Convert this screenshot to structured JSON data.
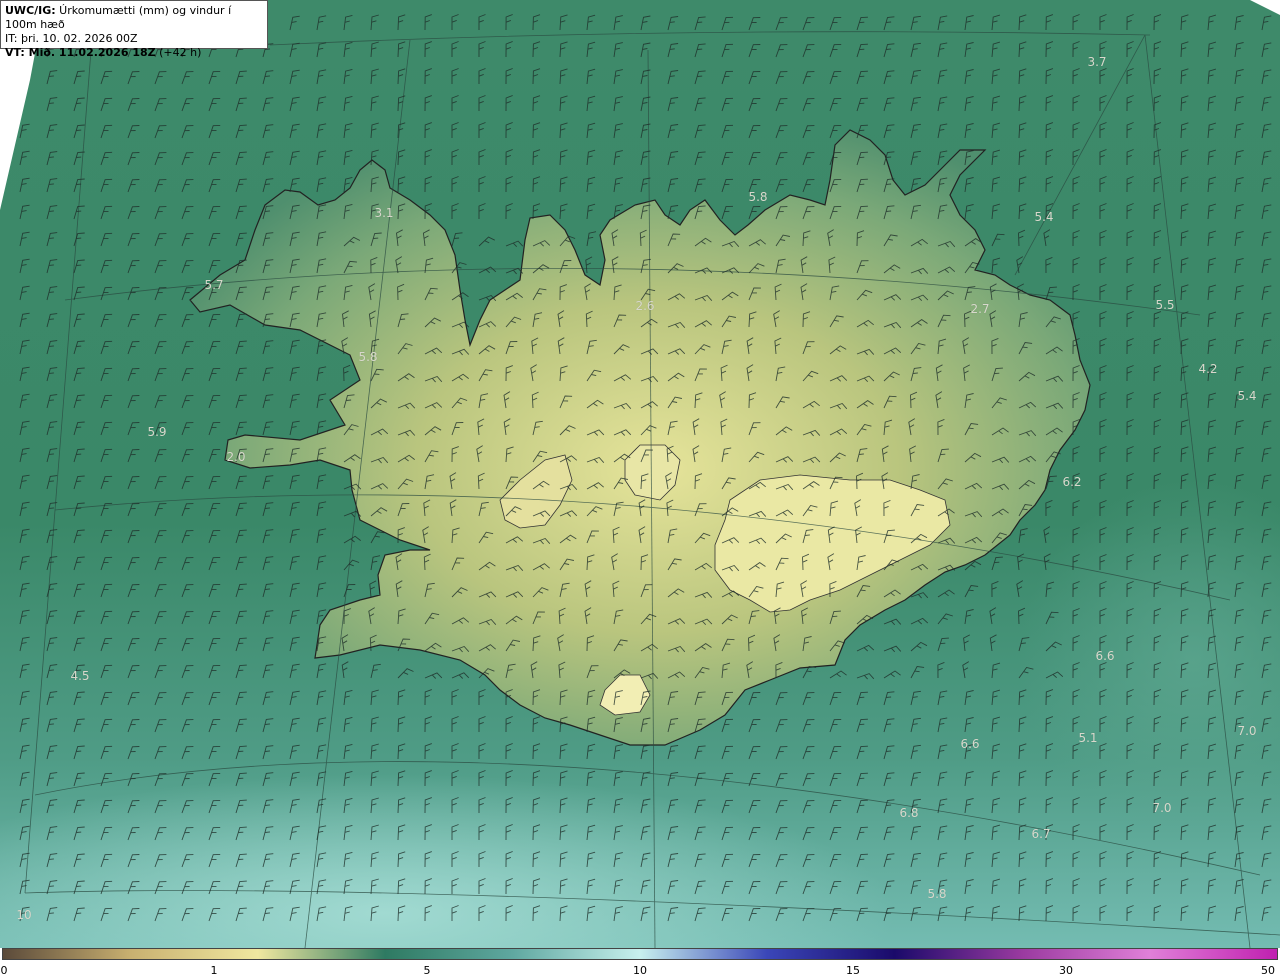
{
  "header": {
    "line1_bold": "UWC/IG:",
    "line1_text": " Úrkomumætti (mm) og vindur í 100m hæð",
    "line2": "IT: þri. 10. 02. 2026 00Z",
    "line3_bold": "VT: Mið. 11.02.2026 18Z",
    "line3_text": " (+42 h)"
  },
  "map_values": [
    {
      "text": "3.7"
    },
    {
      "text": "5.8"
    },
    {
      "text": "5.4"
    },
    {
      "text": "3.1"
    },
    {
      "text": "5.7"
    },
    {
      "text": "2.6"
    },
    {
      "text": "2.7"
    },
    {
      "text": "5.5"
    },
    {
      "text": "5.8"
    },
    {
      "text": "4.2"
    },
    {
      "text": "5.4"
    },
    {
      "text": "5.9"
    },
    {
      "text": "2.0"
    },
    {
      "text": "6.2"
    },
    {
      "text": "6.6"
    },
    {
      "text": "4.5"
    },
    {
      "text": "5.1"
    },
    {
      "text": "7.0"
    },
    {
      "text": "6.6"
    },
    {
      "text": "7.0"
    },
    {
      "text": "6.8"
    },
    {
      "text": "6.7"
    },
    {
      "text": "5.8"
    },
    {
      "text": "10"
    }
  ],
  "colorbar": {
    "ticks": [
      "0",
      "1",
      "5",
      "10",
      "15",
      "30",
      "50"
    ],
    "colors": [
      "#5b4a3a",
      "#c8b070",
      "#f0e8a0",
      "#2e7a62",
      "#5fa8a0",
      "#c8f0ee",
      "#3a46b8",
      "#1a0a6a",
      "#9a3aa0",
      "#e080d8",
      "#c020b0"
    ]
  }
}
